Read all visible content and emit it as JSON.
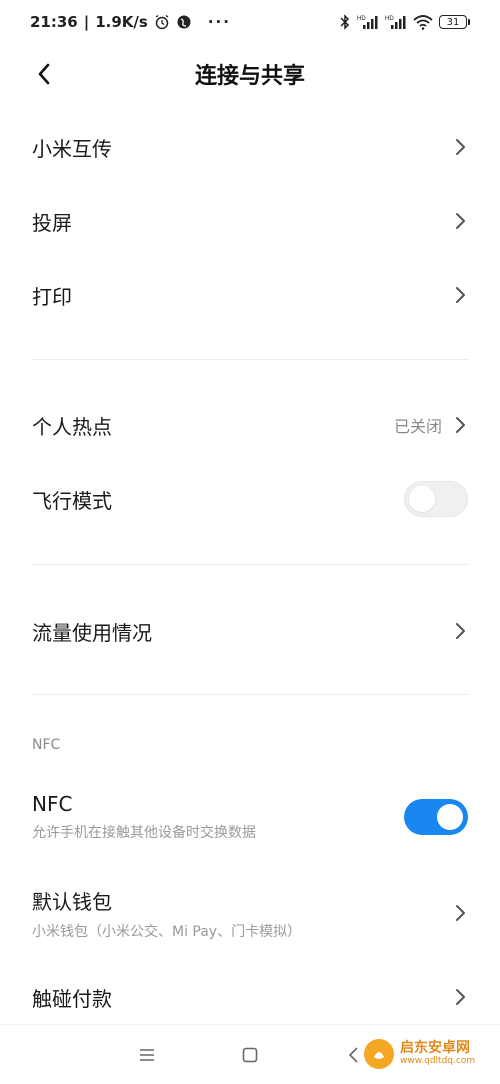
{
  "status_bar": {
    "time": "21:36",
    "speed": "1.9K/s",
    "more": "···",
    "battery": "31"
  },
  "header": {
    "title": "连接与共享"
  },
  "rows": {
    "mi_share": {
      "label": "小米互传"
    },
    "cast": {
      "label": "投屏"
    },
    "print": {
      "label": "打印"
    },
    "hotspot": {
      "label": "个人热点",
      "value": "已关闭"
    },
    "airplane": {
      "label": "飞行模式",
      "state": "off"
    },
    "data_usage": {
      "label": "流量使用情况"
    },
    "nfc_section": "NFC",
    "nfc": {
      "label": "NFC",
      "sub": "允许手机在接触其他设备时交换数据",
      "state": "on"
    },
    "wallet": {
      "label": "默认钱包",
      "sub": "小米钱包（小米公交、Mi Pay、门卡模拟）"
    },
    "tap_pay": {
      "label": "触碰付款"
    }
  },
  "colors": {
    "accent": "#1a87f0",
    "text_primary": "#1a1a1a",
    "text_secondary": "#9a9a9a"
  },
  "watermark": {
    "title": "启东安卓网",
    "url": "www.qdltdq.com"
  },
  "icons": {
    "back": "back-arrow-icon",
    "chevron": "chevron-right-icon",
    "nav_menu": "menu-icon",
    "nav_home": "home-icon",
    "nav_back": "back-icon"
  }
}
